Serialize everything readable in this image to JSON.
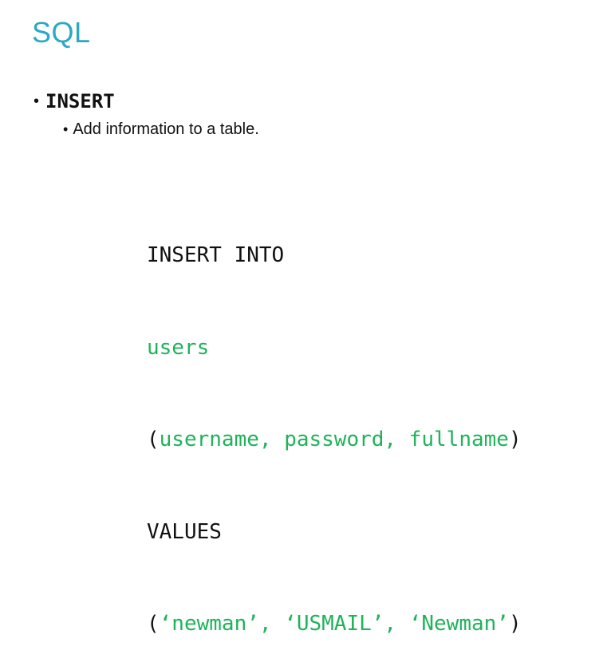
{
  "slide": {
    "title": "SQL",
    "bullet_level1": {
      "symbol": "•",
      "text": "INSERT"
    },
    "bullet_level2": {
      "symbol": "•",
      "text": "Add information to a table."
    }
  },
  "code": {
    "line1": "INSERT INTO",
    "line2": "users",
    "line3_open": "(",
    "line3_cols": "username, password, fullname",
    "line3_close": ")",
    "line4": "VALUES",
    "line5_open": "(",
    "line5_vals": "‘newman’, ‘USMAIL’, ‘Newman’",
    "line5_close": ")"
  },
  "colors": {
    "title": "#2aa8c6",
    "code_highlight": "#1fb35a",
    "text": "#111111"
  }
}
